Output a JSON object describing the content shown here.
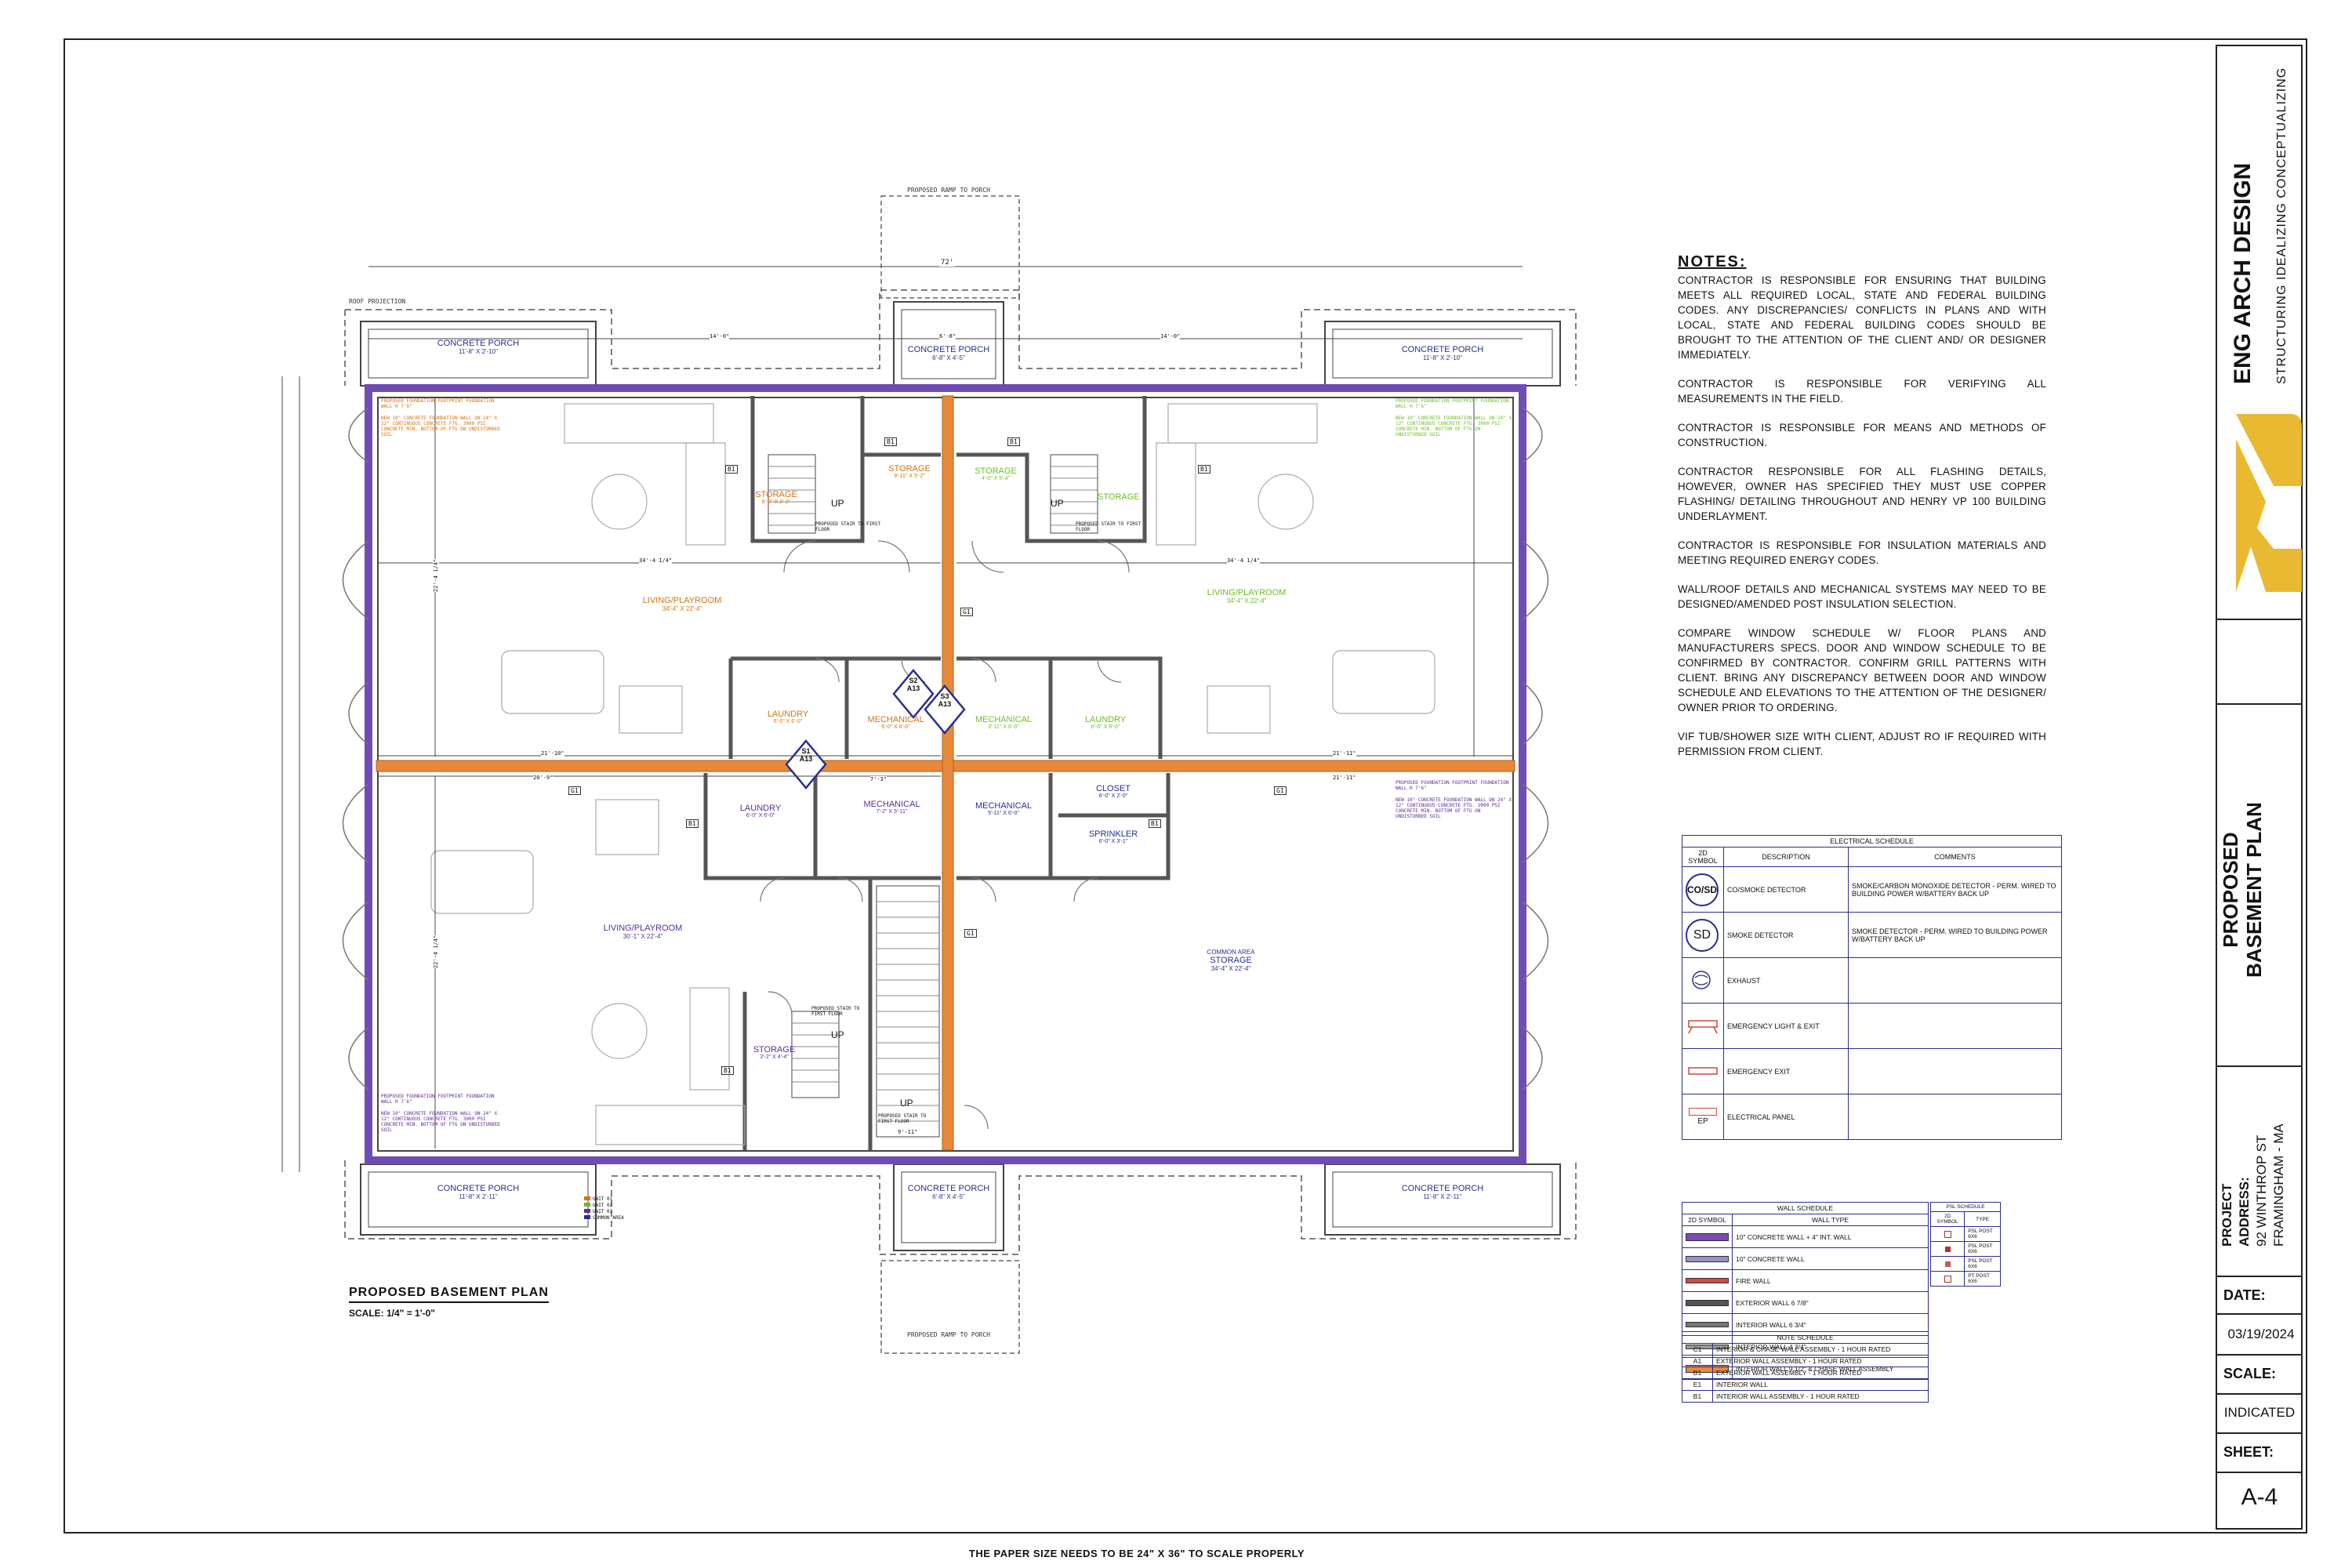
{
  "plan": {
    "title": "PROPOSED BASEMENT PLAN",
    "scale": "SCALE: 1/4\" = 1'-0\"",
    "ramp_top": "PROPOSED RAMP TO PORCH",
    "ramp_bottom": "PROPOSED RAMP TO PORCH",
    "roof_projection": "ROOF PROJECTION",
    "overall_width": "72'",
    "porches": [
      {
        "name": "CONCRETE PORCH",
        "size": "11'-8\" X 2'-10\""
      },
      {
        "name": "CONCRETE PORCH",
        "size": "6'-8\" X 4'-5\""
      },
      {
        "name": "CONCRETE PORCH",
        "size": "11'-8\" X 2'-10\""
      },
      {
        "name": "CONCRETE PORCH",
        "size": "11'-8\" X 2'-11\""
      },
      {
        "name": "CONCRETE PORCH",
        "size": "6'-8\" X 4'-5\""
      },
      {
        "name": "CONCRETE PORCH",
        "size": "11'-8\" X 2'-11\""
      }
    ],
    "rooms": [
      {
        "name": "STORAGE",
        "size": "8'-0\" X 2'-2\"",
        "color": "#d4740f"
      },
      {
        "name": "UP",
        "size": "",
        "color": "#111111"
      },
      {
        "name": "STORAGE",
        "size": "9'-11\" X 5'-2\"",
        "color": "#d4740f"
      },
      {
        "name": "STORAGE",
        "size": "4'-0\" X 5'-4\"",
        "color": "#6cbd2a"
      },
      {
        "name": "UP",
        "size": "",
        "color": "#111111"
      },
      {
        "name": "STORAGE",
        "size": "",
        "color": "#6cbd2a"
      },
      {
        "name": "LIVING/PLAYROOM",
        "size": "34'-4\" X 22'-4\"",
        "color": "#d4740f"
      },
      {
        "name": "LIVING/PLAYROOM",
        "size": "34'-4\" X 22'-4\"",
        "color": "#6cbd2a"
      },
      {
        "name": "LAUNDRY",
        "size": "6'-0\" X 6'-0\"",
        "color": "#d4740f"
      },
      {
        "name": "MECHANICAL",
        "size": "6'-0\" X 6'-0\"",
        "color": "#d4740f"
      },
      {
        "name": "MECHANICAL",
        "size": "3'-11\" X 6'-0\"",
        "color": "#6cbd2a"
      },
      {
        "name": "LAUNDRY",
        "size": "6'-0\" X 6'-0\"",
        "color": "#6cbd2a"
      },
      {
        "name": "LAUNDRY",
        "size": "6'-0\" X 6'-0\"",
        "color": "#5b2d9e"
      },
      {
        "name": "MECHANICAL",
        "size": "7'-2\" X 5'-11\"",
        "color": "#5b2d9e"
      },
      {
        "name": "MECHANICAL",
        "size": "5'-11\" X 6'-0\"",
        "color": "#2a2e8f"
      },
      {
        "name": "CLOSET",
        "size": "6'-0\" X 2'-0\"",
        "color": "#2a2e8f"
      },
      {
        "name": "SPRINKLER",
        "size": "6'-0\" X 3'-1\"",
        "color": "#2a2e8f"
      },
      {
        "name": "LIVING/PLAYROOM",
        "size": "30'-1\" X 22'-4\"",
        "color": "#5b2d9e"
      },
      {
        "name": "STORAGE",
        "size": "34'-4\" X 22'-4\"",
        "color": "#2a2e8f"
      },
      {
        "name": "STORAGE",
        "size": "3'-2\" X 4'-4\"",
        "color": "#5b2d9e"
      },
      {
        "name": "UP",
        "size": "",
        "color": "#111111"
      },
      {
        "name": "UP",
        "size": "",
        "color": "#111111"
      }
    ],
    "common_area_label": "COMMON AREA",
    "stair_notes": [
      "PROPOSED STAIR TO FIRST FLOOR",
      "PROPOSED STAIR TO FIRST FLOOR",
      "PROPOSED STAIR TO FIRST FLOOR",
      "PROPOSED STAIR TO FIRST FLOOR"
    ],
    "foundation_note_a": "PROPOSED FOUNDATION FOOTPRINT FOUNDATION WALL H 7'6\"",
    "foundation_note_b": "NEW 10\" CONCRETE FOUNDATION WALL ON 24\" X 12\" CONTINUOUS CONCRETE FTG. 3000 PSI CONCRETE MIN. BOTTOM OF FTG ON UNDISTURBED SOIL",
    "section_marks": [
      {
        "num": "S2",
        "sheet": "A13"
      },
      {
        "num": "S3",
        "sheet": "A13"
      },
      {
        "num": "S1",
        "sheet": "A13"
      }
    ],
    "dims": [
      "34'-4 1/4\"",
      "34'-4 1/4\"",
      "21'-10\"",
      "21'-11\"",
      "20'-9\"",
      "21'-11\"",
      "7'-3\"",
      "14'-0\"",
      "6'-8\"",
      "14'-0\"",
      "9'-11\"",
      "22'-4 1/4\"",
      "22'-4 1/4\""
    ],
    "wall_tags": [
      "B1",
      "G1"
    ],
    "unit_legend": [
      {
        "label": "UNIT 01",
        "color": "#d4740f"
      },
      {
        "label": "UNIT 02",
        "color": "#6cbd2a"
      },
      {
        "label": "UNIT 03",
        "color": "#5b2d9e"
      },
      {
        "label": "COMMON AREA",
        "color": "#2a2e8f"
      }
    ]
  },
  "notes": {
    "heading": "NOTES:",
    "items": [
      "CONTRACTOR IS RESPONSIBLE FOR ENSURING THAT BUILDING MEETS ALL REQUIRED LOCAL, STATE AND FEDERAL BUILDING CODES. ANY DISCREPANCIES/ CONFLICTS IN PLANS AND WITH LOCAL, STATE AND FEDERAL BUILDING CODES SHOULD BE BROUGHT TO THE ATTENTION OF THE CLIENT AND/ OR DESIGNER IMMEDIATELY.",
      "CONTRACTOR IS RESPONSIBLE FOR VERIFYING ALL MEASUREMENTS IN THE FIELD.",
      "CONTRACTOR IS RESPONSIBLE FOR MEANS AND METHODS OF CONSTRUCTION.",
      "CONTRACTOR RESPONSIBLE FOR ALL FLASHING DETAILS, HOWEVER, OWNER HAS SPECIFIED THEY MUST USE COPPER FLASHING/ DETAILING THROUGHOUT AND HENRY VP 100 BUILDING UNDERLAYMENT.",
      "CONTRACTOR IS RESPONSIBLE FOR INSULATION MATERIALS AND MEETING REQUIRED ENERGY CODES.",
      "WALL/ROOF DETAILS AND MECHANICAL SYSTEMS MAY NEED TO BE DESIGNED/AMENDED POST INSULATION SELECTION.",
      "COMPARE WINDOW SCHEDULE W/ FLOOR PLANS AND MANUFACTURERS SPECS. DOOR AND WINDOW SCHEDULE TO BE CONFIRMED BY CONTRACTOR. CONFIRM GRILL PATTERNS WITH CLIENT. BRING ANY DISCREPANCY BETWEEN DOOR AND WINDOW SCHEDULE AND ELEVATIONS TO THE ATTENTION OF THE DESIGNER/ OWNER PRIOR TO ORDERING.",
      "VIF TUB/SHOWER SIZE WITH CLIENT, ADJUST RO IF REQUIRED WITH PERMISSION FROM CLIENT."
    ]
  },
  "electrical_schedule": {
    "title": "ELECTRICAL SCHEDULE",
    "headers": [
      "2D SYMBOL",
      "DESCRIPTION",
      "COMMENTS"
    ],
    "rows": [
      {
        "symbol": "CO/SD",
        "description": "CO/SMOKE DETECTOR",
        "comment": "SMOKE/CARBON MONOXIDE DETECTOR - PERM. WIRED TO BUILDING POWER W/BATTERY BACK UP"
      },
      {
        "symbol": "SD",
        "description": "SMOKE DETECTOR",
        "comment": "SMOKE DETECTOR - PERM. WIRED TO BUILDING POWER W/BATTERY BACK UP"
      },
      {
        "symbol": "",
        "description": "EXHAUST",
        "comment": ""
      },
      {
        "symbol": "",
        "description": "EMERGENCY LIGHT & EXIT",
        "comment": ""
      },
      {
        "symbol": "",
        "description": "EMERGENCY EXIT",
        "comment": ""
      },
      {
        "symbol": "EP",
        "description": "ELECTRICAL PANEL",
        "comment": ""
      }
    ]
  },
  "wall_schedule": {
    "title": "WALL SCHEDULE",
    "headers": [
      "2D SYMBOL",
      "WALL TYPE"
    ],
    "rows": [
      {
        "type": "10\" CONCRETE WALL + 4\" INT. WALL",
        "color": "#7a4bb8"
      },
      {
        "type": "10\" CONCRETE WALL",
        "color": "#9b8fc9"
      },
      {
        "type": "FIRE WALL",
        "color": "#d04a4a"
      },
      {
        "type": "EXTERIOR WALL 6 7/8\"",
        "color": "#555555"
      },
      {
        "type": "INTERIOR WALL 6 3/4\"",
        "color": "#777777"
      },
      {
        "type": "INTERIOR WALL 4 3/4\"",
        "color": "#999999"
      },
      {
        "type": "INTERIOR WALL 9 1/2\" & CHASE WALL ASSEMBLY",
        "color": "#e8883a"
      }
    ]
  },
  "psl_schedule": {
    "title": "PSL SCHEDULE",
    "headers": [
      "2D SYMBOL",
      "TYPE"
    ],
    "rows": [
      "PSL POST 6x6",
      "PSL POST 6x6",
      "PSL POST 6x6",
      "PT POST 6x6"
    ]
  },
  "note_schedule": {
    "title": "NOTE SCHEDULE",
    "rows": [
      {
        "tag": "C1",
        "text": "INTERIOR & CHASE WALL ASSEMBLY - 1 HOUR RATED"
      },
      {
        "tag": "A1",
        "text": "EXTERIOR WALL ASSEMBLY - 1 HOUR RATED"
      },
      {
        "tag": "B1",
        "text": "EXTERIOR WALL ASSEMBLY - 1 HOUR RATED"
      },
      {
        "tag": "E1",
        "text": "INTERIOR WALL"
      },
      {
        "tag": "B1",
        "text": "INTERIOR WALL ASSEMBLY - 1 HOUR RATED"
      }
    ]
  },
  "title_block": {
    "firm": "ENG ARCH DESIGN",
    "tagline": "STRUCTURING IDEALIZING CONCEPTUALIZING",
    "sheet_title_1": "PROPOSED",
    "sheet_title_2": "BASEMENT PLAN",
    "project_label_1": "PROJECT",
    "project_label_2": "ADDRESS:",
    "address_1": "92 WINTHROP ST",
    "address_2": "FRAMINGHAM - MA",
    "date_label": "DATE:",
    "date": "03/19/2024",
    "scale_label": "SCALE:",
    "scale": "INDICATED",
    "sheet_label": "SHEET:",
    "sheet": "A-4"
  },
  "footer": "THE PAPER SIZE NEEDS TO BE 24\" X 36\" TO SCALE PROPERLY"
}
